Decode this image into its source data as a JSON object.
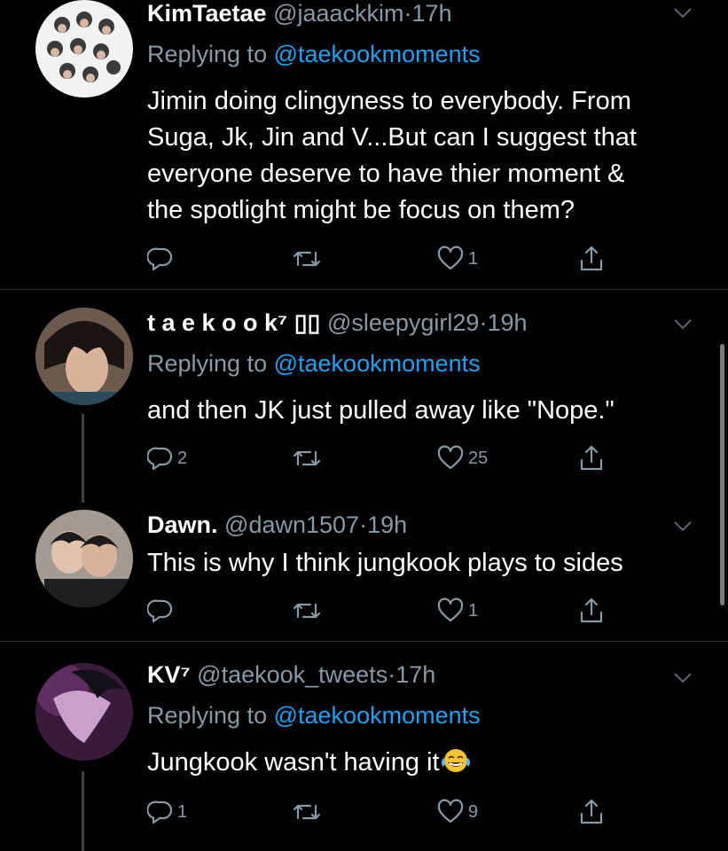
{
  "tweets": [
    {
      "name": "KimTaetae",
      "handle": "@jaaackkim",
      "dot": "·",
      "time": "17h",
      "reply_prefix": "Replying to",
      "reply_to": "@taekookmoments",
      "body_lines": [
        "Jimin doing clingyness to everybody. From",
        "Suga, Jk, Jin and V...But can I suggest that",
        "everyone deserve to have thier moment &",
        "the spotlight might be focus on them?"
      ],
      "replies": "",
      "retweets": "",
      "likes": "1"
    },
    {
      "name": "t a e k o o k⁷ ▯▯",
      "handle": "@sleepygirl29",
      "dot": "·",
      "time": "19h",
      "reply_prefix": "Replying to",
      "reply_to": "@taekookmoments",
      "body_lines": [
        "and then JK just pulled away like \"Nope.\""
      ],
      "replies": "2",
      "retweets": "",
      "likes": "25"
    },
    {
      "name": "Dawn.",
      "handle": "@dawn1507",
      "dot": "·",
      "time": "19h",
      "body_lines": [
        "This is why I think jungkook plays to sides"
      ],
      "replies": "",
      "retweets": "",
      "likes": "1"
    },
    {
      "name": "KV⁷",
      "handle": "@taekook_tweets",
      "dot": "·",
      "time": "17h",
      "reply_prefix": "Replying to",
      "reply_to": "@taekookmoments",
      "body_lines": [
        "Jungkook wasn't having it"
      ],
      "emoji": "face-with-tears-of-joy",
      "replies": "1",
      "retweets": "",
      "likes": "9"
    }
  ],
  "colors": {
    "background": "#000000",
    "secondary_text": "#8899a6",
    "link": "#1da1f2",
    "divider": "#2f3336"
  },
  "icons": [
    "reply-icon",
    "retweet-icon",
    "like-icon",
    "share-icon",
    "chevron-down-icon"
  ]
}
